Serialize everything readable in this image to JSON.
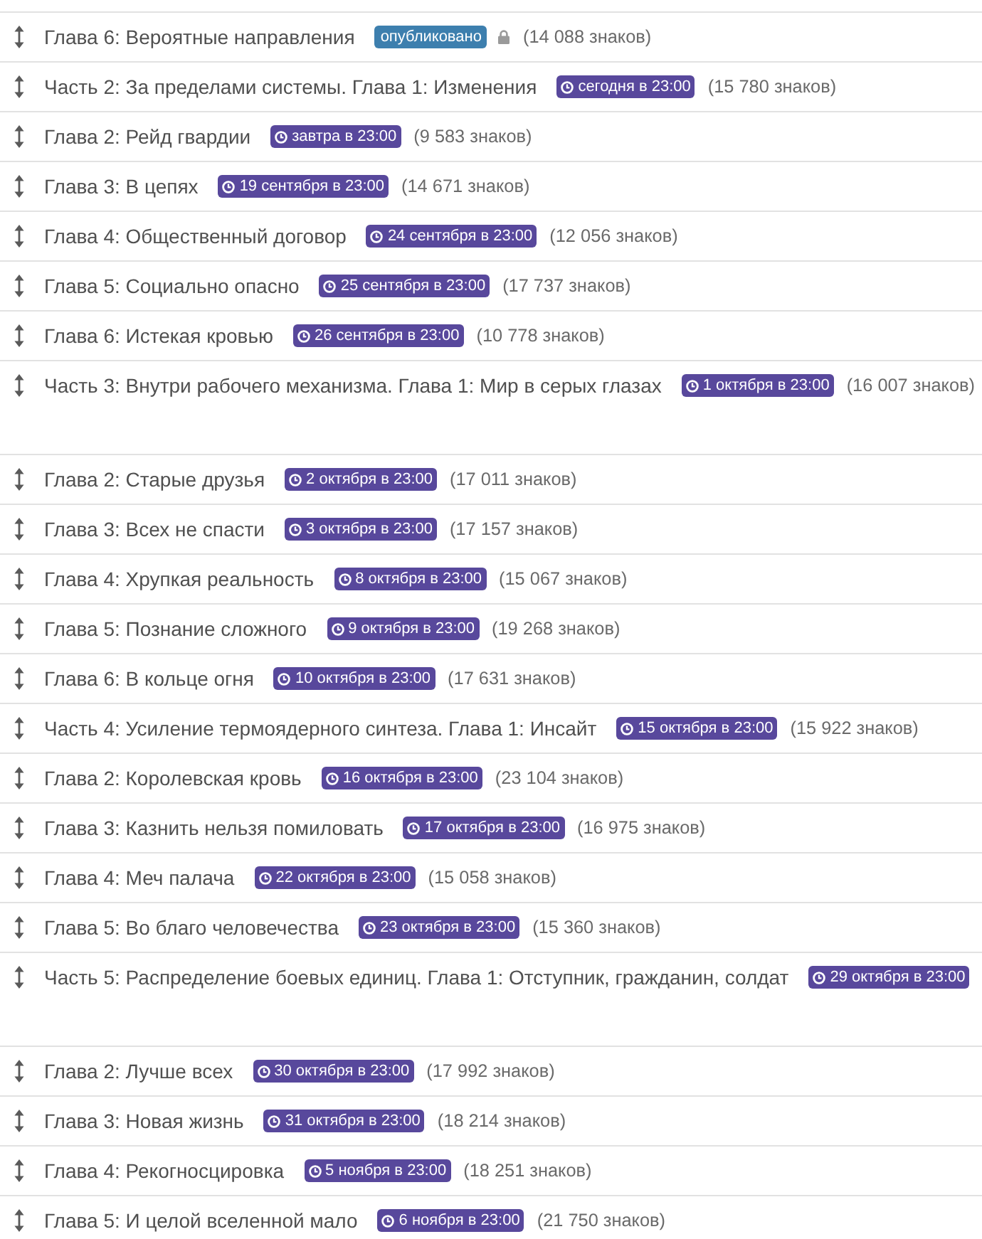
{
  "chapters": [
    {
      "kind": "normal",
      "title": "Глава 6: Вероятные направления",
      "status": {
        "kind": "published",
        "label": "опубликовано"
      },
      "locked": true,
      "chars": "(14 088 знаков)"
    },
    {
      "kind": "normal",
      "title": "Часть 2: За пределами системы. Глава 1: Изменения",
      "status": {
        "kind": "scheduled",
        "label": "сегодня в 23:00"
      },
      "locked": false,
      "chars": "(15 780 знаков)"
    },
    {
      "kind": "normal",
      "title": "Глава 2: Рейд гвардии",
      "status": {
        "kind": "scheduled",
        "label": "завтра в 23:00"
      },
      "locked": false,
      "chars": "(9 583 знаков)"
    },
    {
      "kind": "normal",
      "title": "Глава 3: В цепях",
      "status": {
        "kind": "scheduled",
        "label": "19 сентября в 23:00"
      },
      "locked": false,
      "chars": "(14 671 знаков)"
    },
    {
      "kind": "normal",
      "title": "Глава 4: Общественный договор",
      "status": {
        "kind": "scheduled",
        "label": "24 сентября в 23:00"
      },
      "locked": false,
      "chars": "(12 056 знаков)"
    },
    {
      "kind": "normal",
      "title": "Глава 5: Социально опасно",
      "status": {
        "kind": "scheduled",
        "label": "25 сентября в 23:00"
      },
      "locked": false,
      "chars": "(17 737 знаков)"
    },
    {
      "kind": "normal",
      "title": "Глава 6: Истекая кровью",
      "status": {
        "kind": "scheduled",
        "label": "26 сентября в 23:00"
      },
      "locked": false,
      "chars": "(10 778 знаков)"
    },
    {
      "kind": "tall",
      "title": "Часть 3: Внутри рабочего механизма. Глава 1: Мир в серых глазах",
      "status": {
        "kind": "scheduled",
        "label": "1 октября в 23:00"
      },
      "locked": false,
      "chars": "(16 007 знаков)"
    },
    {
      "kind": "normal",
      "title": "Глава 2: Старые друзья",
      "status": {
        "kind": "scheduled",
        "label": "2 октября в 23:00"
      },
      "locked": false,
      "chars": "(17 011 знаков)"
    },
    {
      "kind": "normal",
      "title": "Глава 3: Всех не спасти",
      "status": {
        "kind": "scheduled",
        "label": "3 октября в 23:00"
      },
      "locked": false,
      "chars": "(17 157 знаков)"
    },
    {
      "kind": "normal",
      "title": "Глава 4: Хрупкая реальность",
      "status": {
        "kind": "scheduled",
        "label": "8 октября в 23:00"
      },
      "locked": false,
      "chars": "(15 067 знаков)"
    },
    {
      "kind": "normal",
      "title": "Глава 5: Познание сложного",
      "status": {
        "kind": "scheduled",
        "label": "9 октября в 23:00"
      },
      "locked": false,
      "chars": "(19 268 знаков)"
    },
    {
      "kind": "normal",
      "title": "Глава 6: В кольце огня",
      "status": {
        "kind": "scheduled",
        "label": "10 октября в 23:00"
      },
      "locked": false,
      "chars": "(17 631 знаков)"
    },
    {
      "kind": "normal",
      "title": "Часть 4: Усиление термоядерного синтеза. Глава 1: Инсайт",
      "status": {
        "kind": "scheduled",
        "label": "15 октября в 23:00"
      },
      "locked": false,
      "chars": "(15 922 знаков)"
    },
    {
      "kind": "normal",
      "title": "Глава 2: Королевская кровь",
      "status": {
        "kind": "scheduled",
        "label": "16 октября в 23:00"
      },
      "locked": false,
      "chars": "(23 104 знаков)"
    },
    {
      "kind": "normal",
      "title": "Глава 3: Казнить нельзя помиловать",
      "status": {
        "kind": "scheduled",
        "label": "17 октября в 23:00"
      },
      "locked": false,
      "chars": "(16 975 знаков)"
    },
    {
      "kind": "normal",
      "title": "Глава 4: Меч палача",
      "status": {
        "kind": "scheduled",
        "label": "22 октября в 23:00"
      },
      "locked": false,
      "chars": "(15 058 знаков)"
    },
    {
      "kind": "normal",
      "title": "Глава 5: Во благо человечества",
      "status": {
        "kind": "scheduled",
        "label": "23 октября в 23:00"
      },
      "locked": false,
      "chars": "(15 360 знаков)"
    },
    {
      "kind": "tall",
      "title": "Часть 5: Распределение боевых единиц. Глава 1: Отступник, гражданин, солдат",
      "status": {
        "kind": "scheduled",
        "label": "29 октября в 23:00"
      },
      "locked": false
    },
    {
      "kind": "normal",
      "title": "Глава 2: Лучше всех",
      "status": {
        "kind": "scheduled",
        "label": "30 октября в 23:00"
      },
      "locked": false,
      "chars": "(17 992 знаков)"
    },
    {
      "kind": "normal",
      "title": "Глава 3: Новая жизнь",
      "status": {
        "kind": "scheduled",
        "label": "31 октября в 23:00"
      },
      "locked": false,
      "chars": "(18 214 знаков)"
    },
    {
      "kind": "normal",
      "title": "Глава 4: Рекогносцировка",
      "status": {
        "kind": "scheduled",
        "label": "5 ноября в 23:00"
      },
      "locked": false,
      "chars": "(18 251 знаков)"
    },
    {
      "kind": "normal",
      "title": "Глава 5: И целой вселенной мало",
      "status": {
        "kind": "scheduled",
        "label": "6 ноября в 23:00"
      },
      "locked": false,
      "chars": "(21 750 знаков)"
    }
  ]
}
